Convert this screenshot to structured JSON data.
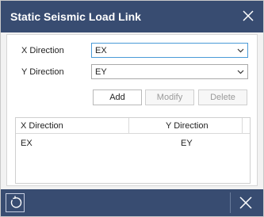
{
  "window": {
    "title": "Static Seismic Load Link"
  },
  "form": {
    "x_direction": {
      "label": "X Direction",
      "value": "EX"
    },
    "y_direction": {
      "label": "Y Direction",
      "value": "EY"
    }
  },
  "buttons": {
    "add": "Add",
    "modify": "Modify",
    "delete": "Delete"
  },
  "table": {
    "columns": [
      "X Direction",
      "Y Direction"
    ],
    "rows": [
      {
        "x": "EX",
        "y": "EY"
      }
    ]
  },
  "icons": {
    "close": "close-icon",
    "reset": "reset-icon",
    "dropdown": "chevron-down-icon"
  },
  "colors": {
    "titlebar": "#384c71",
    "focus_border": "#4a9ad8"
  }
}
